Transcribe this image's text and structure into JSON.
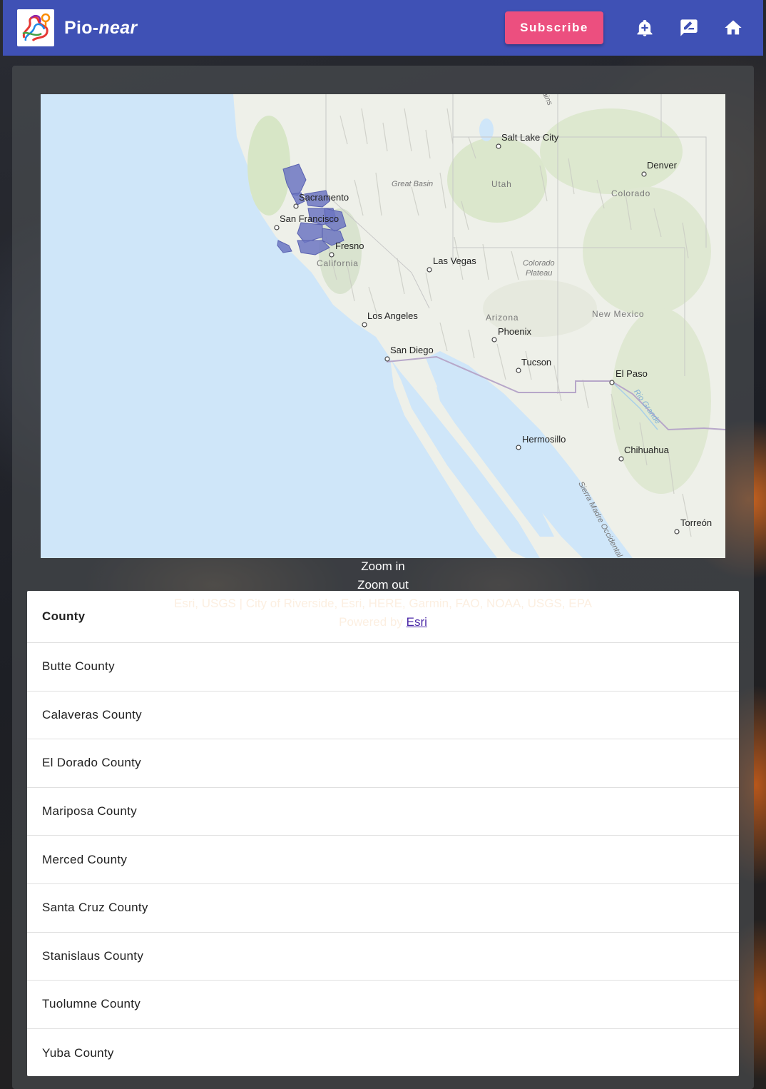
{
  "header": {
    "title_main": "Pio-",
    "title_ital": "near",
    "subscribe_label": "Subscribe",
    "brand_color": "#3f51b5",
    "accent_color": "#ec4f7f",
    "icons": [
      "add-alert-icon",
      "rate-review-icon",
      "home-icon"
    ]
  },
  "map": {
    "labels": {
      "salt_lake_city": "Salt Lake City",
      "denver": "Denver",
      "great_basin": "Great Basin",
      "utah": "Utah",
      "colorado": "Colorado",
      "sacramento": "Sacramento",
      "san_francisco": "San Francisco",
      "fresno": "Fresno",
      "california": "California",
      "las_vegas": "Las Vegas",
      "colorado_plateau_1": "Colorado",
      "colorado_plateau_2": "Plateau",
      "los_angeles": "Los Angeles",
      "arizona": "Arizona",
      "new_mexico": "New Mexico",
      "phoenix": "Phoenix",
      "san_diego": "San Diego",
      "tucson": "Tucson",
      "el_paso": "El Paso",
      "rio_grande": "Rio Grande",
      "hermosillo": "Hermosillo",
      "chihuahua": "Chihuahua",
      "sierra_madre": "Sierra Madre Occidental",
      "torreon": "Torreón",
      "mountains_partial": "ains"
    },
    "zoom_in": "Zoom in",
    "zoom_out": "Zoom out",
    "attribution": "Esri, USGS | City of Riverside, Esri, HERE, Garmin, FAO, NOAA, USGS, EPA",
    "powered_by": "Powered by ",
    "powered_link": "Esri"
  },
  "table": {
    "header": "County",
    "rows": [
      "Butte County",
      "Calaveras County",
      "El Dorado County",
      "Mariposa County",
      "Merced County",
      "Santa Cruz County",
      "Stanislaus County",
      "Tuolumne County",
      "Yuba County"
    ]
  }
}
